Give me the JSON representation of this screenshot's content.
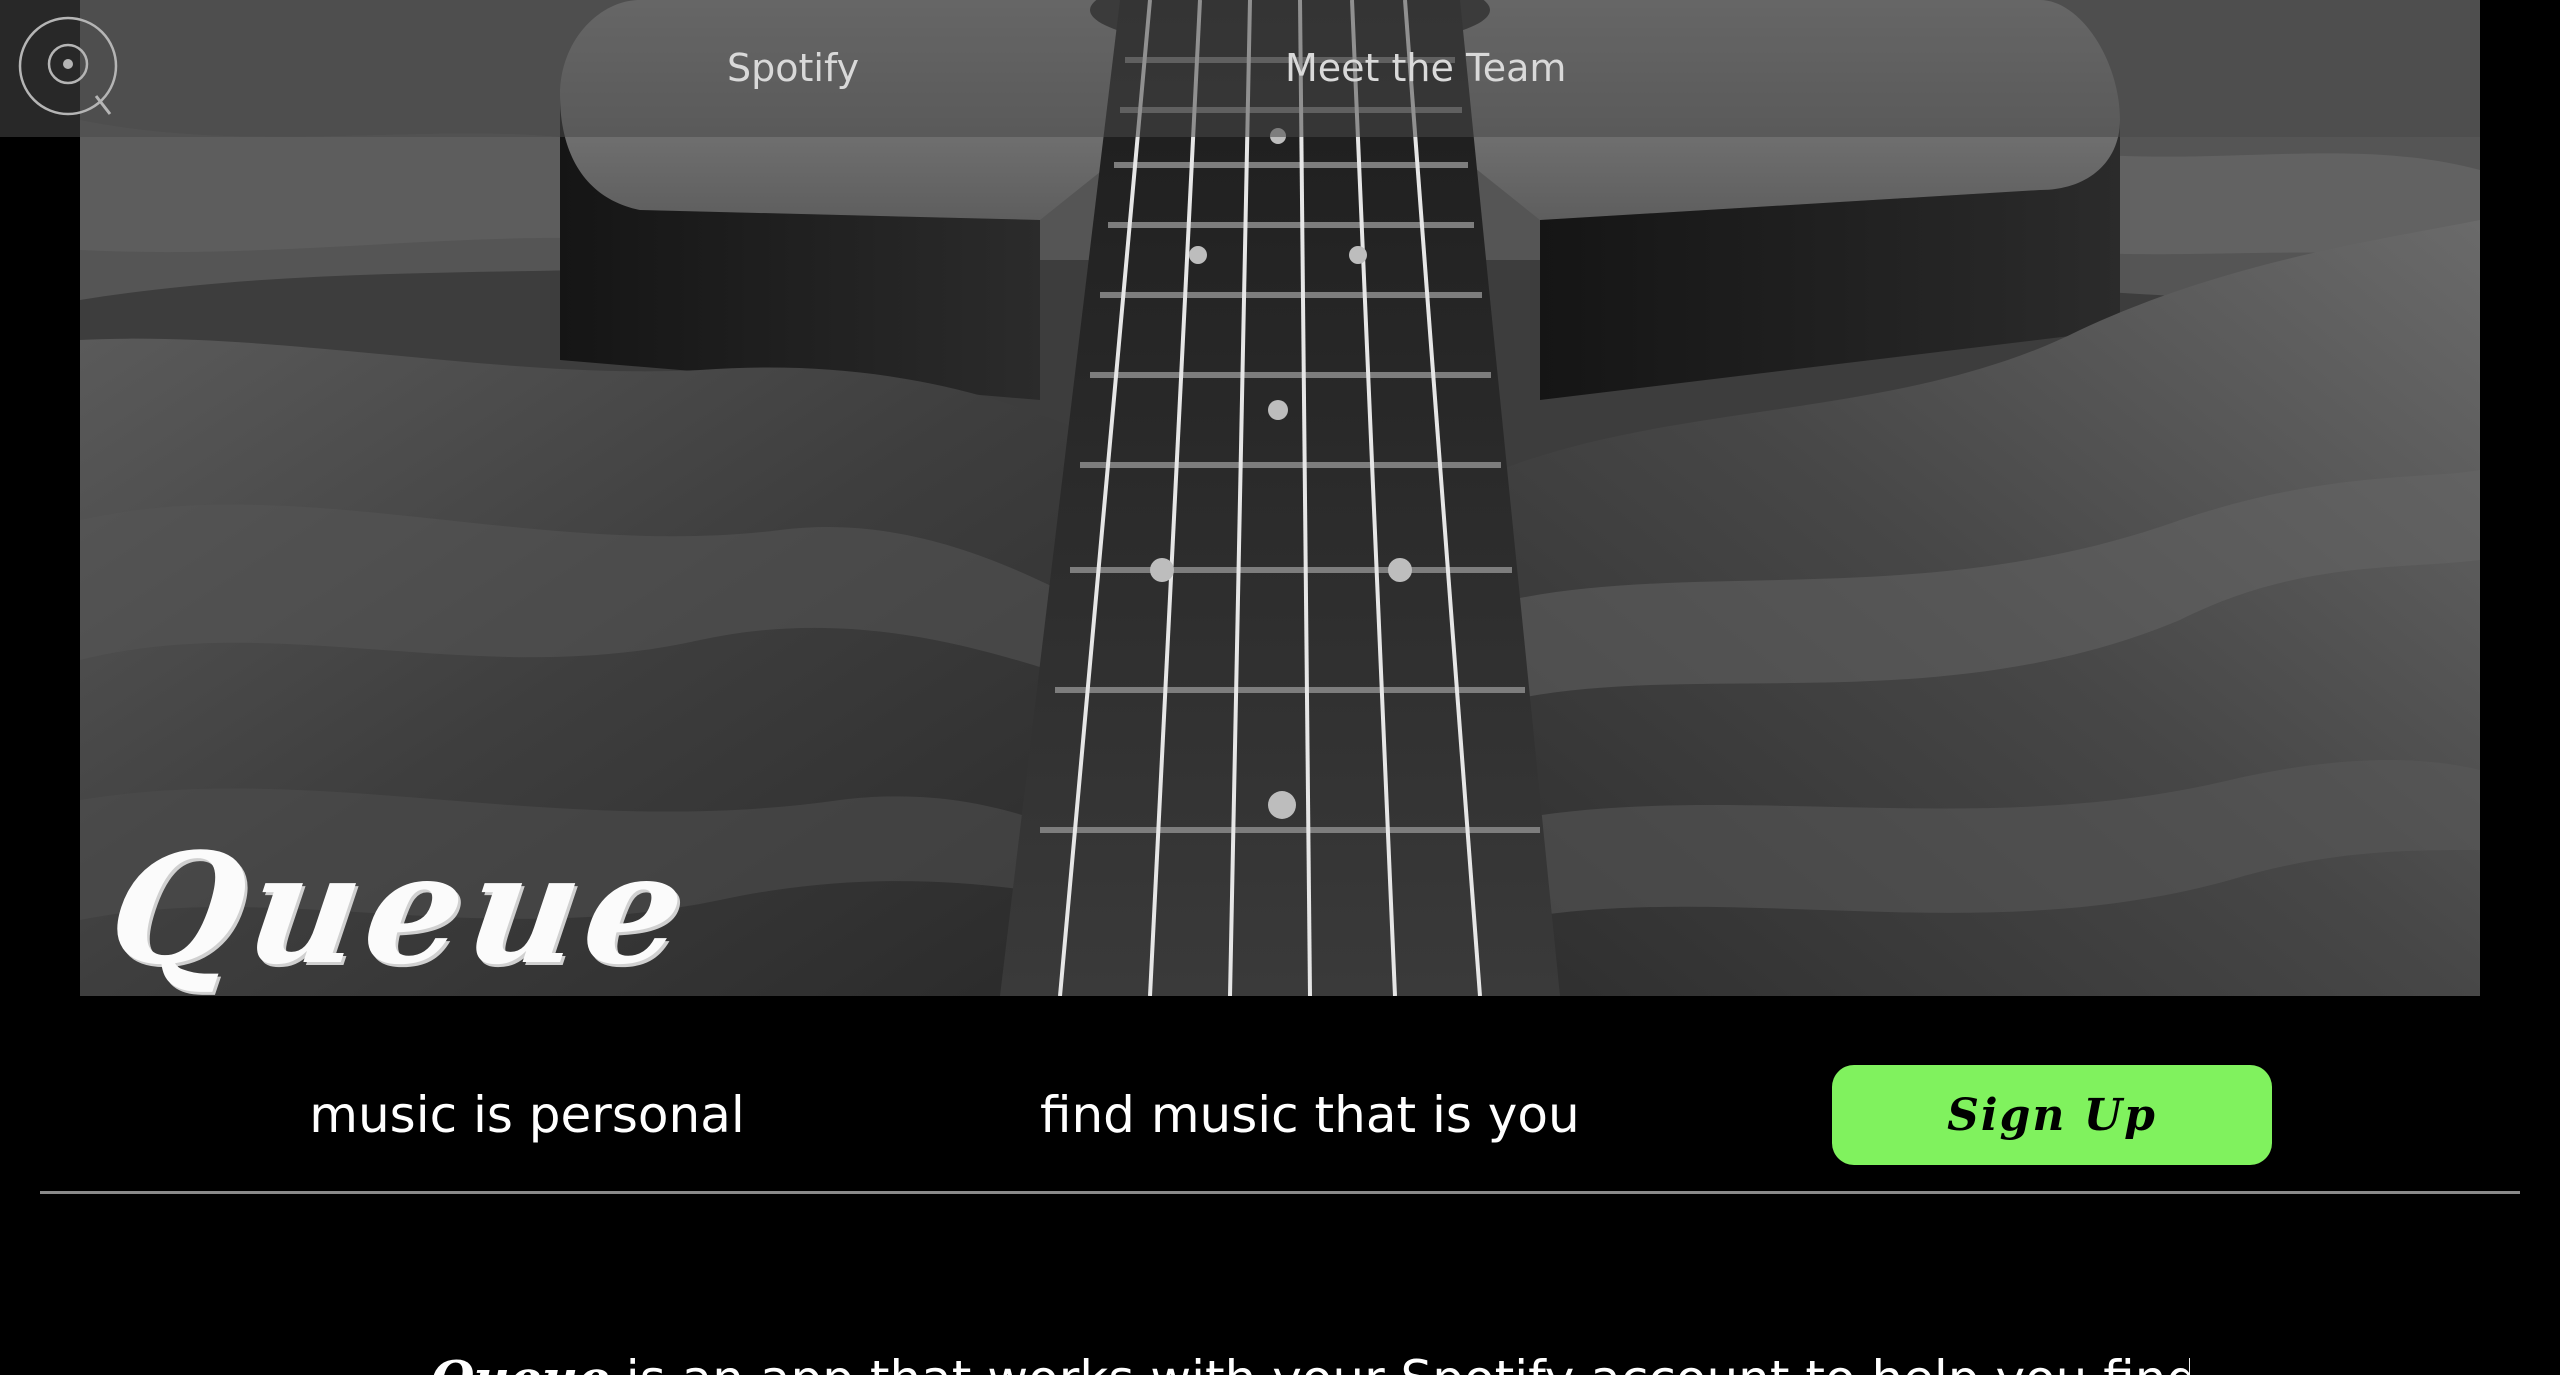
{
  "nav": {
    "logo_icon": "vinyl-search-icon",
    "links": [
      {
        "label": "Spotify"
      },
      {
        "label": "Meet the Team"
      }
    ]
  },
  "hero": {
    "title": "Queue",
    "image": "guitar-on-blanket-photo"
  },
  "taglines": [
    "music is personal",
    "find music that is you"
  ],
  "signup": {
    "label": "Sign Up"
  },
  "intro": {
    "brand": "Queue",
    "text": " is an app that works with your Spotify account to help you find the"
  },
  "colors": {
    "background": "#000000",
    "accent": "#80f25e",
    "nav_overlay": "#484848",
    "divider": "#8a8a8a",
    "text": "#ffffff"
  }
}
